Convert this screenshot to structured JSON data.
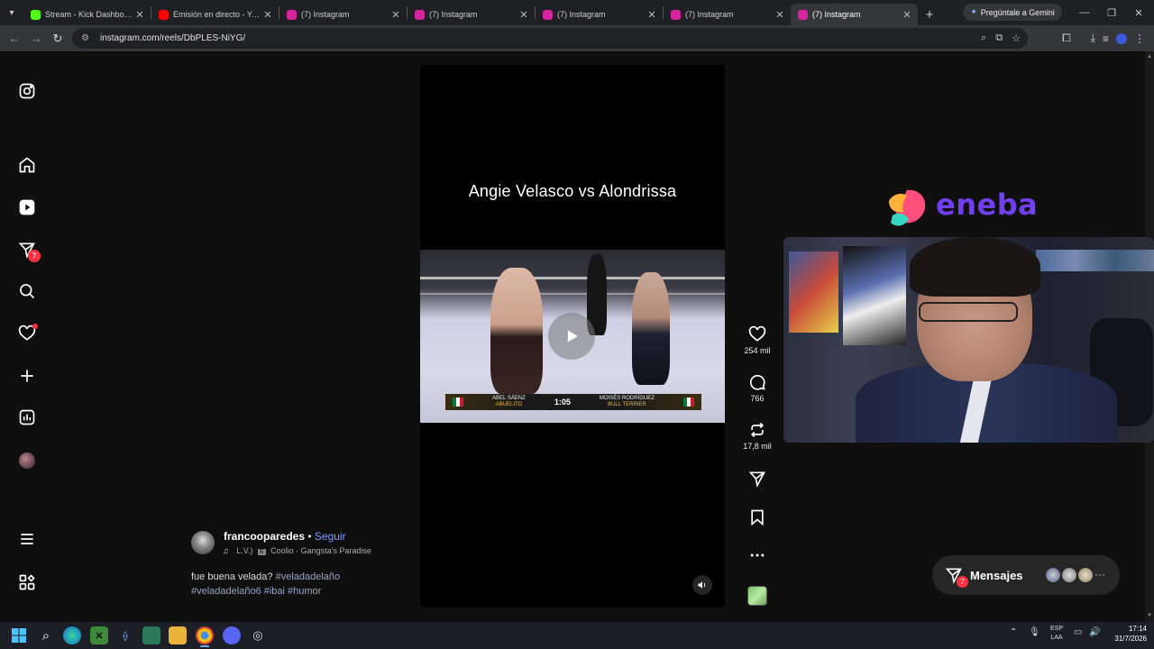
{
  "browser": {
    "tabs": [
      {
        "title": "Stream - Kick Dashboard",
        "favicon_color": "#53fc18"
      },
      {
        "title": "Emisión en directo - YouTube",
        "favicon_color": "#ff0000"
      },
      {
        "title": "(7) Instagram",
        "favicon_color": "#d6249f"
      },
      {
        "title": "(7) Instagram",
        "favicon_color": "#d6249f"
      },
      {
        "title": "(7) Instagram",
        "favicon_color": "#d6249f"
      },
      {
        "title": "(7) Instagram",
        "favicon_color": "#d6249f"
      },
      {
        "title": "(7) Instagram",
        "favicon_color": "#d6249f"
      }
    ],
    "active_tab_index": 6,
    "gemini_label": "Pregúntale a Gemini",
    "url": "instagram.com/reels/DbPLES-NiYG/"
  },
  "sidebar": {
    "items": [
      {
        "name": "instagram-logo-icon"
      },
      {
        "name": "home-icon"
      },
      {
        "name": "reels-icon"
      },
      {
        "name": "direct-icon"
      },
      {
        "name": "search-icon"
      },
      {
        "name": "notifications-icon"
      },
      {
        "name": "create-icon"
      },
      {
        "name": "dashboard-icon"
      },
      {
        "name": "profile-avatar"
      },
      {
        "name": "menu-icon"
      },
      {
        "name": "more-apps-icon"
      }
    ],
    "direct_badge": "7"
  },
  "reel": {
    "overlay_title": "Angie Velasco vs Alondrissa",
    "scoreboard": {
      "left_fighter": "ABEL SÁENZ",
      "left_sub": "ABUELITO",
      "time": "1:05",
      "right_fighter": "MOISÉS RODRÍGUEZ",
      "right_sub": "BULL TERRIER"
    }
  },
  "actions": {
    "likes": "254 mil",
    "comments": "766",
    "reposts": "17,8 mil"
  },
  "post": {
    "author": "francooparedes",
    "separator": "•",
    "follow": "Seguir",
    "audio_prefix": "L.V.)",
    "explicit": "E",
    "audio": "Coolio · Gangsta's Paradise",
    "caption_text": "fue buena velada?",
    "hashtags_line1": "#veladadelaño",
    "hashtags_line2": "#veladadelaño6 #ibai #humor"
  },
  "overlay": {
    "brand": "eneba"
  },
  "messages": {
    "label": "Mensajes",
    "badge": "7"
  },
  "taskbar": {
    "lang_top": "ESP",
    "lang_bottom": "LAA",
    "time": "17:14",
    "date": "31/7/2026"
  },
  "colors": {
    "accent_link": "#7c9bff",
    "badge_red": "#ff3040",
    "eneba_purple": "#6f3ff0"
  }
}
